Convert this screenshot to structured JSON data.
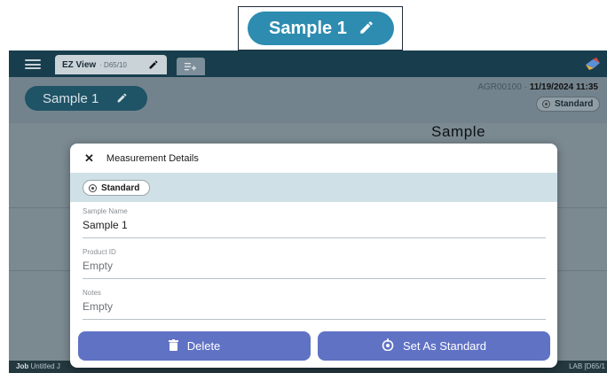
{
  "callout": {
    "label": "Sample 1",
    "icon": "pencil-icon"
  },
  "topbar": {
    "menu_icon": "hamburger-menu-icon",
    "tab_title": "EZ View",
    "tab_sub": "· D65/10",
    "tab_icon": "pencil-icon",
    "new_tab_icon": "add-tab-icon",
    "brand_icon": "app-logo-icon"
  },
  "subheader": {
    "sample_label": "Sample 1",
    "instrument": "AGR00100",
    "datetime": "11/19/2024 11:35",
    "standard_chip": "Standard"
  },
  "main": {
    "heading": "Sample"
  },
  "bottombar": {
    "job_label": "Job",
    "job_value": "Untitled J",
    "right_text": "LAB [D65/1"
  },
  "modal": {
    "title": "Measurement Details",
    "close_icon": "close-icon",
    "standard_chip": "Standard",
    "fields": [
      {
        "label": "Sample Name",
        "value": "Sample 1"
      },
      {
        "label": "Product ID",
        "value": "Empty"
      },
      {
        "label": "Notes",
        "value": "Empty"
      }
    ],
    "delete_label": "Delete",
    "set_standard_label": "Set As Standard"
  },
  "colors": {
    "accent": "#6072c4",
    "topbar": "#183e4e",
    "callout_pill": "#2d8cb0",
    "band": "#cfe1e6"
  }
}
